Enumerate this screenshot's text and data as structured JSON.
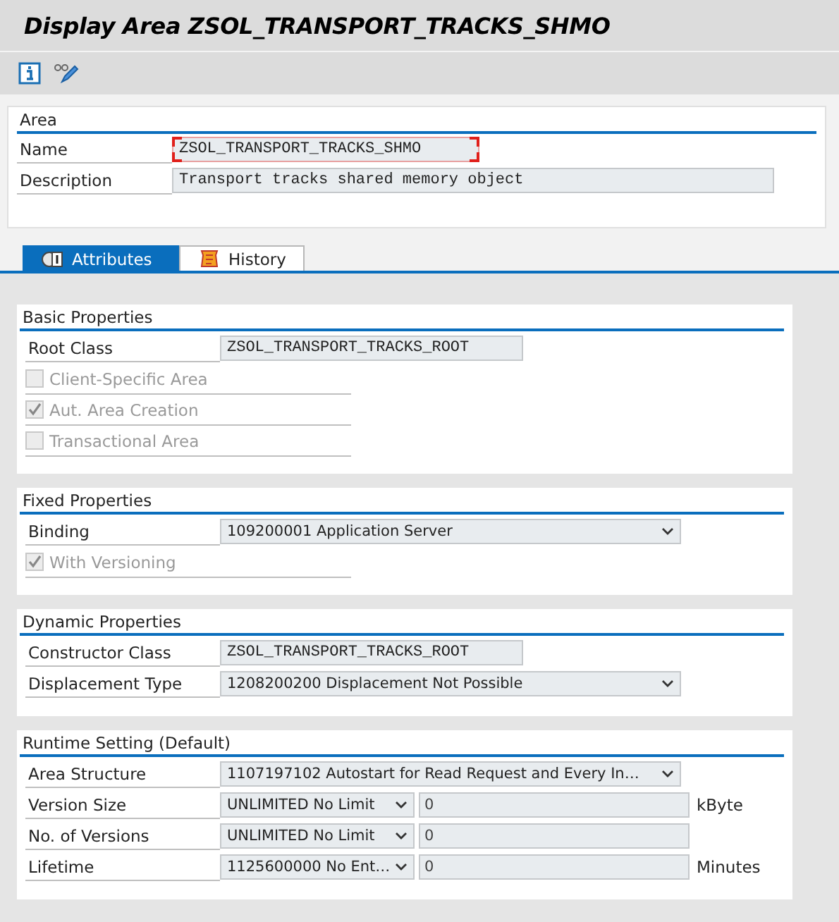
{
  "window": {
    "title": "Display Area ZSOL_TRANSPORT_TRACKS_SHMO"
  },
  "area": {
    "title": "Area",
    "fields": [
      {
        "label": "Name",
        "value": "ZSOL_TRANSPORT_TRACKS_SHMO",
        "focused": true
      },
      {
        "label": "Description",
        "value": "Transport tracks shared memory object",
        "focused": false
      }
    ]
  },
  "tabs": [
    {
      "label": "Attributes",
      "selected": true
    },
    {
      "label": "History",
      "selected": false
    }
  ],
  "sections": [
    {
      "title": "Basic Properties",
      "rows": [
        {
          "kind": "text",
          "label": "Root Class",
          "value": "ZSOL_TRANSPORT_TRACKS_ROOT"
        },
        {
          "kind": "checkbox",
          "label": "Client-Specific Area",
          "checked": false,
          "disabled": true
        },
        {
          "kind": "checkbox",
          "label": "Aut. Area Creation",
          "checked": true,
          "disabled": true
        },
        {
          "kind": "checkbox",
          "label": "Transactional Area",
          "checked": false,
          "disabled": true
        }
      ]
    },
    {
      "title": "Fixed Properties",
      "rows": [
        {
          "kind": "dropdown",
          "label": "Binding",
          "value": "109200001 Application Server"
        },
        {
          "kind": "checkbox",
          "label": "With Versioning",
          "checked": true,
          "disabled": true
        }
      ]
    },
    {
      "title": "Dynamic Properties",
      "rows": [
        {
          "kind": "text",
          "label": "Constructor Class",
          "value": "ZSOL_TRANSPORT_TRACKS_ROOT"
        },
        {
          "kind": "dropdown",
          "label": "Displacement Type",
          "value": "1208200200 Displacement Not Possible"
        }
      ]
    },
    {
      "title": "Runtime Setting (Default)",
      "rows": [
        {
          "kind": "dropdown",
          "label": "Area Structure",
          "value": "1107197102 Autostart for Read Request and Every In…"
        },
        {
          "kind": "limit",
          "label": "Version Size",
          "value": "UNLIMITED No Limit",
          "amount": "0",
          "unit": "kByte"
        },
        {
          "kind": "limit",
          "label": "No. of Versions",
          "value": "UNLIMITED No Limit",
          "amount": "0"
        },
        {
          "kind": "limit",
          "label": "Lifetime",
          "value": "1125600000 No Ent…",
          "amount": "0",
          "unit": "Minutes"
        }
      ]
    }
  ]
}
